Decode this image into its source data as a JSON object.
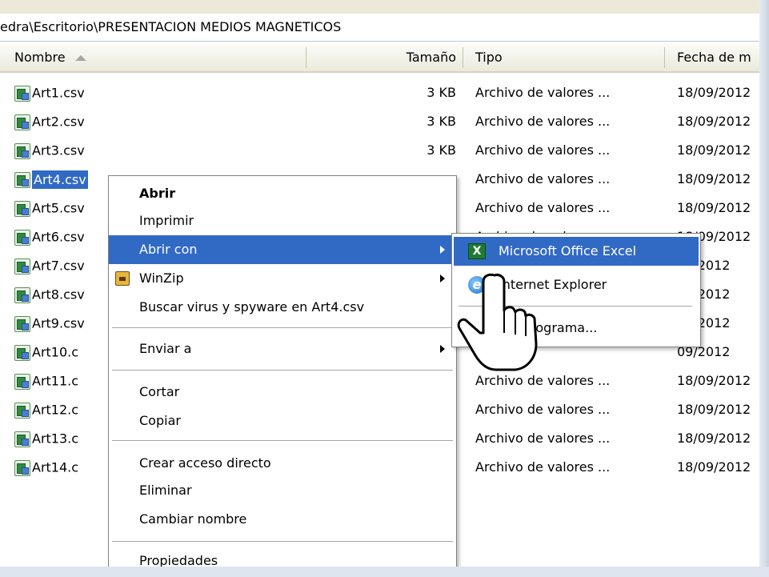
{
  "address_path": "edra\\Escritorio\\PRESENTACION MEDIOS MAGNETICOS",
  "columns": {
    "name": "Nombre",
    "size": "Tamaño",
    "type": "Tipo",
    "date": "Fecha de m"
  },
  "files": [
    {
      "name": "Art1.csv",
      "size": "3 KB",
      "type": "Archivo de valores ...",
      "date": "18/09/2012"
    },
    {
      "name": "Art2.csv",
      "size": "3 KB",
      "type": "Archivo de valores ...",
      "date": "18/09/2012"
    },
    {
      "name": "Art3.csv",
      "size": "3 KB",
      "type": "Archivo de valores ...",
      "date": "18/09/2012"
    },
    {
      "name": "Art4.csv",
      "size": "",
      "type": "Archivo de valores ...",
      "date": "18/09/2012",
      "selected": true
    },
    {
      "name": "Art5.csv",
      "size": "",
      "type": "Archivo de valores ...",
      "date": "18/09/2012"
    },
    {
      "name": "Art6.csv",
      "size": "",
      "type": "Archivo de valores ...",
      "date": "18/09/2012"
    },
    {
      "name": "Art7.csv",
      "size": "",
      "type": "",
      "date": "09/2012"
    },
    {
      "name": "Art8.csv",
      "size": "",
      "type": "",
      "date": "09/2012"
    },
    {
      "name": "Art9.csv",
      "size": "",
      "type": "",
      "date": "09/2012"
    },
    {
      "name": "Art10.c",
      "size": "",
      "type": "",
      "date": "09/2012"
    },
    {
      "name": "Art11.c",
      "size": "",
      "type": "Archivo de valores ...",
      "date": "18/09/2012"
    },
    {
      "name": "Art12.c",
      "size": "",
      "type": "Archivo de valores ...",
      "date": "18/09/2012"
    },
    {
      "name": "Art13.c",
      "size": "",
      "type": "Archivo de valores ...",
      "date": "18/09/2012"
    },
    {
      "name": "Art14.c",
      "size": "",
      "type": "Archivo de valores ...",
      "date": "18/09/2012"
    }
  ],
  "context_menu": {
    "open": "Abrir",
    "print": "Imprimir",
    "open_with": "Abrir con",
    "winzip": "WinZip",
    "scan": "Buscar virus y spyware en Art4.csv",
    "send_to": "Enviar a",
    "cut": "Cortar",
    "copy": "Copiar",
    "create_shortcut": "Crear acceso directo",
    "delete": "Eliminar",
    "rename": "Cambiar nombre",
    "properties": "Propiedades"
  },
  "submenu": {
    "excel": "Microsoft Office Excel",
    "ie": "Internet Explorer",
    "choose_program": "programa..."
  },
  "colors": {
    "selection": "#316ac5",
    "header_bg": "#ebeadb"
  }
}
